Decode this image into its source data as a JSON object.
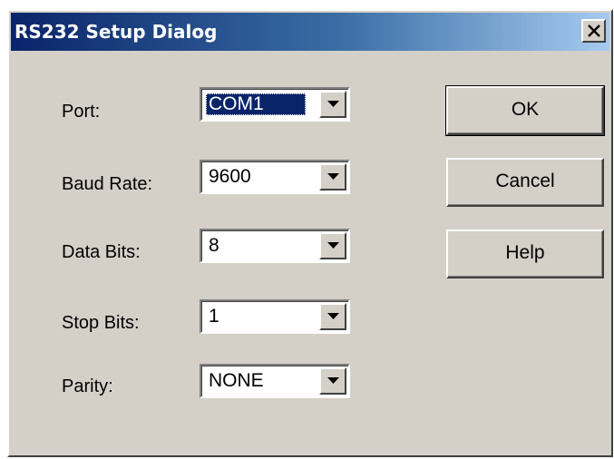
{
  "window": {
    "title": "RS232 Setup Dialog",
    "close_glyph": "×",
    "title_gradient": [
      "#0a246a",
      "#a6caf0"
    ],
    "face_color": "#d4d0c8"
  },
  "fields": [
    {
      "label": "Port:",
      "value": "COM1"
    },
    {
      "label": "Baud Rate:",
      "value": "9600"
    },
    {
      "label": "Data Bits:",
      "value": "8"
    },
    {
      "label": "Stop Bits:",
      "value": "1"
    },
    {
      "label": "Parity:",
      "value": "NONE"
    }
  ],
  "buttons": {
    "ok": "OK",
    "cancel": "Cancel",
    "help": "Help"
  },
  "icons": {
    "close": "close-icon",
    "dropdown": "chevron-down-icon"
  }
}
